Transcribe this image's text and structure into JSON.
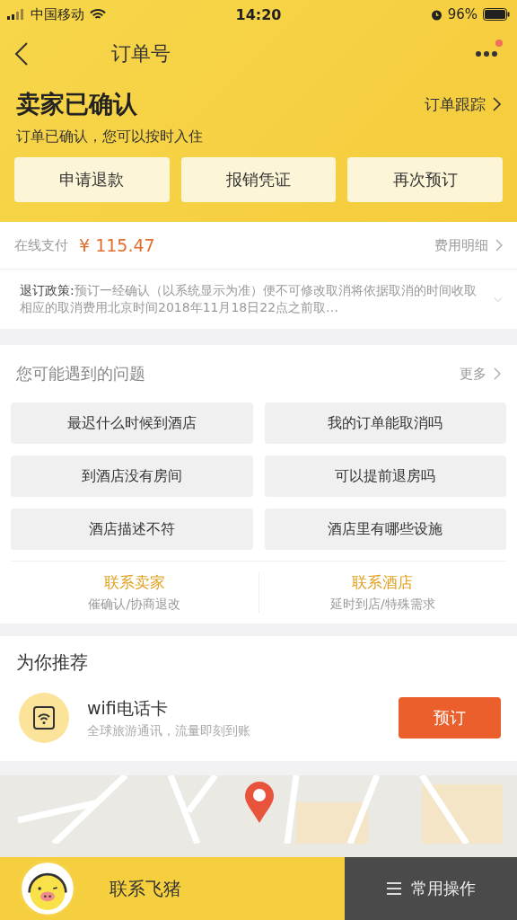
{
  "status_bar": {
    "carrier": "中国移动",
    "time": "14:20",
    "battery": "96%"
  },
  "nav": {
    "title": "订单号",
    "has_notification": true
  },
  "order_status": {
    "title": "卖家已确认",
    "subtitle": "订单已确认，您可以按时入住",
    "tracking_link": "订单跟踪"
  },
  "actions": [
    "申请退款",
    "报销凭证",
    "再次预订"
  ],
  "payment": {
    "label": "在线支付",
    "amount": "¥ 115.47",
    "details_link": "费用明细"
  },
  "policy": {
    "label": "退订政策:",
    "text": "预订一经确认（以系统显示为准）便不可修改取消将依据取消的时间收取相应的取消费用北京时间2018年11月18日22点之前取…",
    "expanded": false
  },
  "faq": {
    "title": "您可能遇到的问题",
    "more_link": "更多",
    "questions": [
      "最迟什么时候到酒店",
      "我的订单能取消吗",
      "到酒店没有房间",
      "可以提前退房吗",
      "酒店描述不符",
      "酒店里有哪些设施"
    ]
  },
  "contacts": [
    {
      "title": "联系卖家",
      "subtitle": "催确认/协商退改"
    },
    {
      "title": "联系酒店",
      "subtitle": "延时到店/特殊需求"
    }
  ],
  "recommend": {
    "title": "为你推荐",
    "item": {
      "name": "wifi电话卡",
      "description": "全球旅游通讯，流量即刻到账",
      "button": "预订"
    }
  },
  "bottom_bar": {
    "contact": "联系飞猪",
    "operations": "常用操作"
  }
}
